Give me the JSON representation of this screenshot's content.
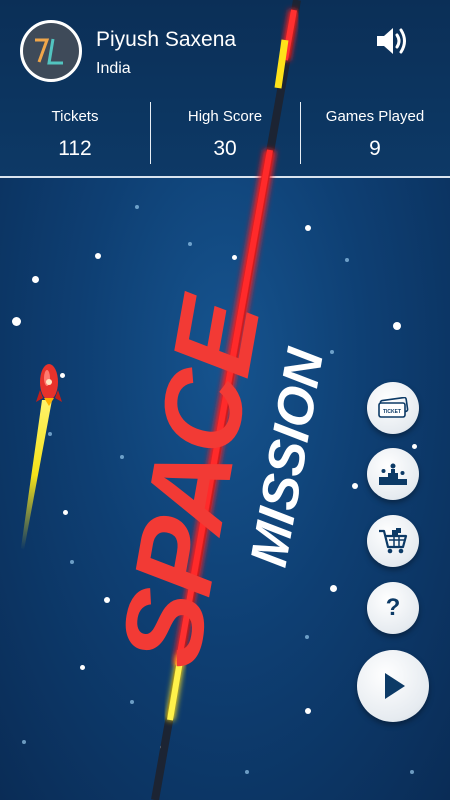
{
  "profile": {
    "name": "Piyush Saxena",
    "country": "India",
    "avatar_letters": "7L"
  },
  "stats": [
    {
      "label": "Tickets",
      "value": "112"
    },
    {
      "label": "High Score",
      "value": "30"
    },
    {
      "label": "Games Played",
      "value": "9"
    }
  ],
  "title": {
    "line1": "SPACE",
    "line2": "MISSION"
  },
  "icons": {
    "sound": "speaker-icon",
    "tickets": "ticket-icon",
    "leaderboard": "podium-icon",
    "shop": "cart-icon",
    "help": "question-icon",
    "play": "play-icon"
  },
  "help_label": "?",
  "colors": {
    "title_red": "#f23a35",
    "laser_red": "#ff1a1a",
    "laser_yellow": "#ffe21a",
    "background": "#0e3f73"
  }
}
